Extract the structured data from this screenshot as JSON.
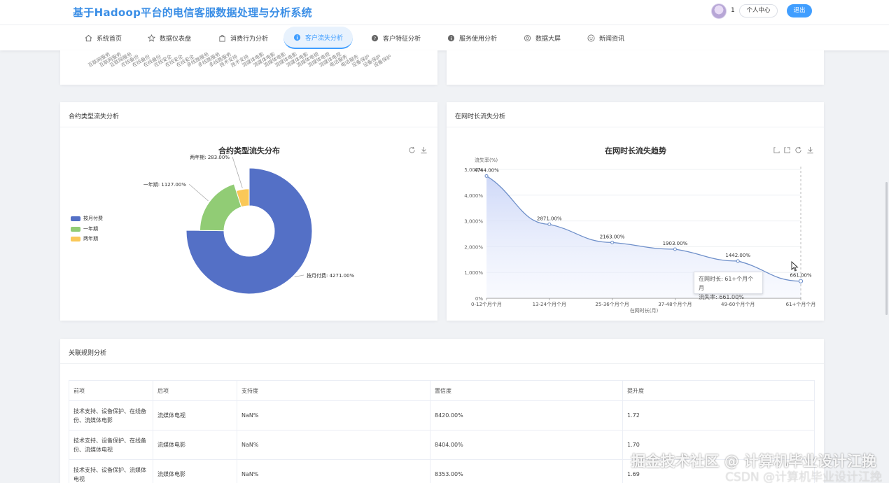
{
  "header": {
    "title": "基于Hadoop平台的电信客服数据处理与分析系统",
    "user_id": "1",
    "profile_label": "个人中心",
    "logout_label": "退出"
  },
  "nav": {
    "items": [
      {
        "label": "系统首页",
        "icon": "home-icon"
      },
      {
        "label": "数据仪表盘",
        "icon": "star-icon"
      },
      {
        "label": "消费行为分析",
        "icon": "bag-icon"
      },
      {
        "label": "客户流失分析",
        "icon": "info-icon"
      },
      {
        "label": "客户特征分析",
        "icon": "question-icon"
      },
      {
        "label": "服务使用分析",
        "icon": "info-icon"
      },
      {
        "label": "数据大屏",
        "icon": "settings-icon"
      },
      {
        "label": "新闻资讯",
        "icon": "smile-icon"
      }
    ],
    "active_index": 3
  },
  "top_card": {
    "rotated_labels": [
      "互联网服务",
      "互联网服务",
      "互联网服务",
      "在线备份",
      "在线备份",
      "在线备份",
      "在线安全",
      "在线安全",
      "在线安全",
      "多线路服务",
      "多线路服务",
      "多线路服务",
      "技术支持",
      "技术支持",
      "流媒体电影",
      "流媒体电影",
      "流媒体电影",
      "流媒体电影",
      "流媒体电影",
      "流媒体电视",
      "流媒体电视",
      "流媒体电视",
      "电话服务",
      "电话服务",
      "设备保护",
      "设备保护",
      "设备保护"
    ]
  },
  "contract_card": {
    "card_title": "合约类型流失分析",
    "chart_title": "合约类型流失分布",
    "legend": [
      "按月付费",
      "一年期",
      "两年期"
    ],
    "labels": [
      "按月付费: 4271.00%",
      "一年期: 1127.00%",
      "两年期: 283.00%"
    ]
  },
  "tenure_card": {
    "card_title": "在网时长流失分析",
    "chart_title": "在网时长流失趋势",
    "y_unit": "流失率(%)",
    "x_title": "在网时长(月)",
    "y_ticks": [
      "0%",
      "1,000%",
      "2,000%",
      "3,000%",
      "4,000%",
      "5,000%"
    ],
    "tooltip_line1": "在网时长: 61+个月个月",
    "tooltip_line2": "流失率: 661.00%"
  },
  "assoc_card": {
    "card_title": "关联规则分析",
    "columns": [
      "前项",
      "后项",
      "支持度",
      "置信度",
      "提升度"
    ],
    "rows": [
      [
        "技术支持、设备保护、在线备份、流媒体电影",
        "流媒体电视",
        "NaN%",
        "8420.00%",
        "1.72"
      ],
      [
        "技术支持、设备保护、在线备份、流媒体电视",
        "流媒体电影",
        "NaN%",
        "8404.00%",
        "1.70"
      ],
      [
        "技术支持、设备保护、流媒体电视",
        "流媒体电影",
        "NaN%",
        "8353.00%",
        "1.69"
      ]
    ]
  },
  "watermark": {
    "main": "掘金技术社区 @ 计算机毕业设计江挽",
    "sub": "CSDN @计算机毕业设计江挽"
  },
  "colors": {
    "primary": "#409eff",
    "pie_monthly": "#5470c6",
    "pie_one_year": "#91cc75",
    "pie_two_year": "#fac858",
    "line": "#6e8fc9"
  },
  "chart_data": [
    {
      "type": "pie",
      "title": "合约类型流失分布",
      "legend_position": "left",
      "categories": [
        "按月付费",
        "一年期",
        "两年期"
      ],
      "values": [
        4271,
        1127,
        283
      ],
      "value_unit": "%"
    },
    {
      "type": "area",
      "title": "在网时长流失趋势",
      "xlabel": "在网时长(月)",
      "ylabel": "流失率(%)",
      "categories": [
        "0-12个月个月",
        "13-24个月个月",
        "25-36个月个月",
        "37-48个月个月",
        "49-60个月个月",
        "61+个月个月"
      ],
      "values": [
        4744,
        2871,
        2163,
        1903,
        1442,
        661
      ],
      "data_labels": [
        "4744.00%",
        "2871.00%",
        "2163.00%",
        "1903.00%",
        "1442.00%",
        "661.00%"
      ],
      "ylim": [
        0,
        5000
      ],
      "grid": true
    }
  ]
}
